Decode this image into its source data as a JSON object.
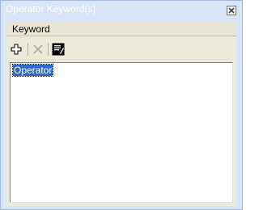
{
  "window": {
    "title": "Operator Keyword(s)"
  },
  "panel": {
    "header_label": "Keyword"
  },
  "toolbar": {
    "buttons": [
      {
        "icon": "plus-icon",
        "enabled": true
      },
      {
        "icon": "close-x-icon",
        "enabled": false
      },
      {
        "icon": "edit-icon",
        "enabled": true
      }
    ]
  },
  "list": {
    "items": [
      {
        "label": "Operator",
        "selected": true
      }
    ]
  },
  "colors": {
    "title_bar": "#d8e4f8",
    "panel_bg": "#ece9d8",
    "selection_bg": "#316ac5"
  }
}
